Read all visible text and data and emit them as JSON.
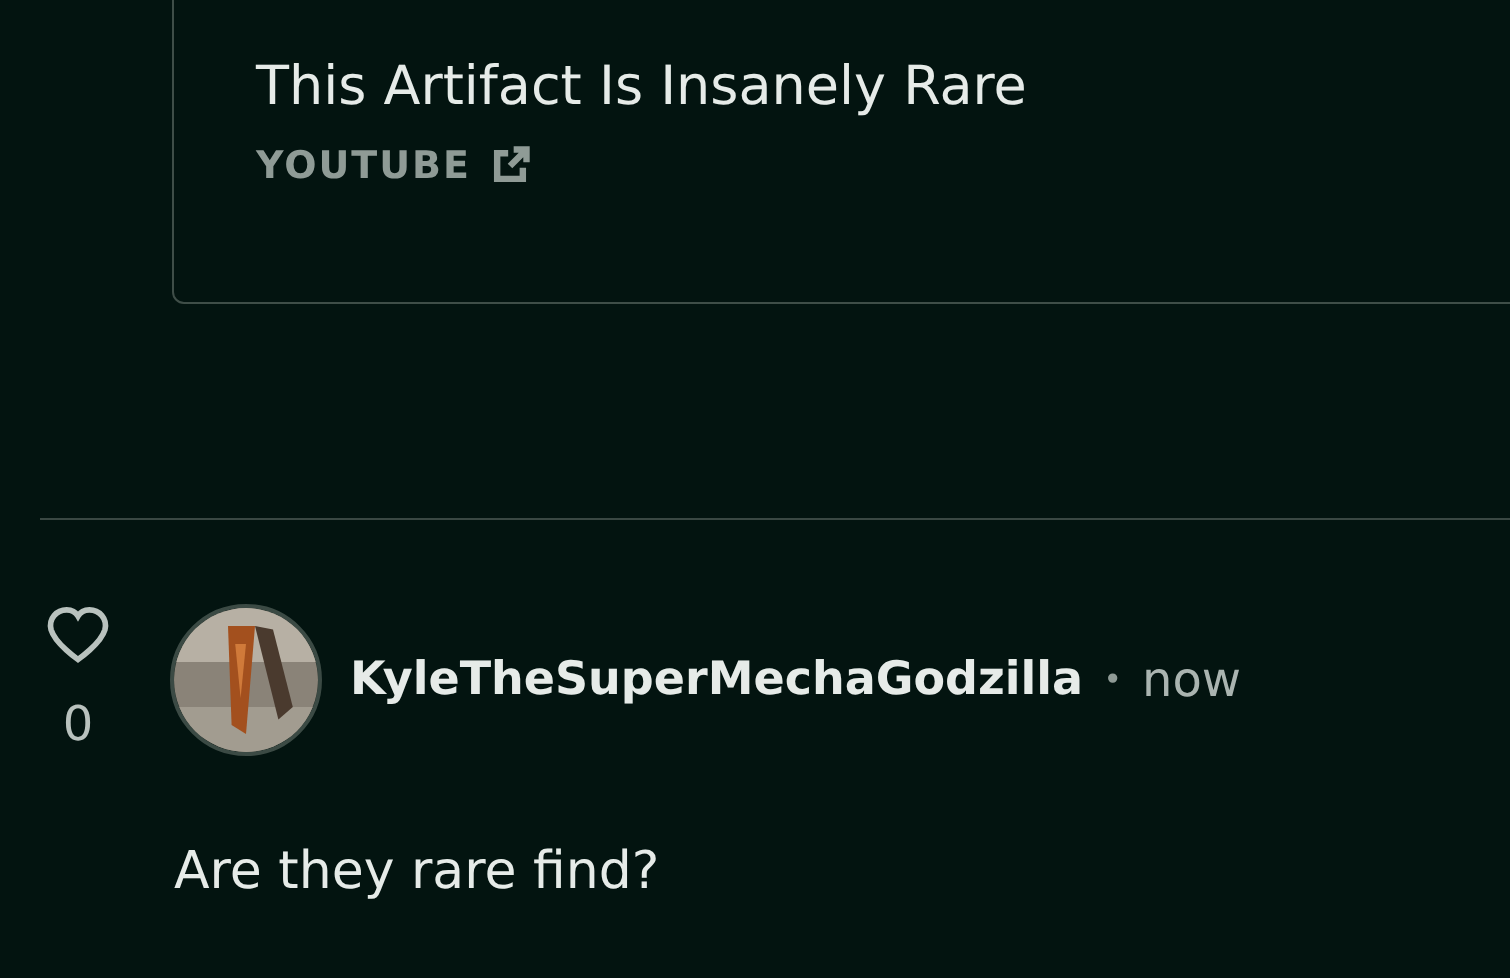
{
  "link_card": {
    "title": "This Artifact Is Insanely Rare",
    "source": "YOUTUBE"
  },
  "comment": {
    "likes": "0",
    "liked": false,
    "username": "KyleTheSuperMechaGodzilla",
    "separator": "•",
    "time": "now",
    "text": "Are they rare find?"
  }
}
